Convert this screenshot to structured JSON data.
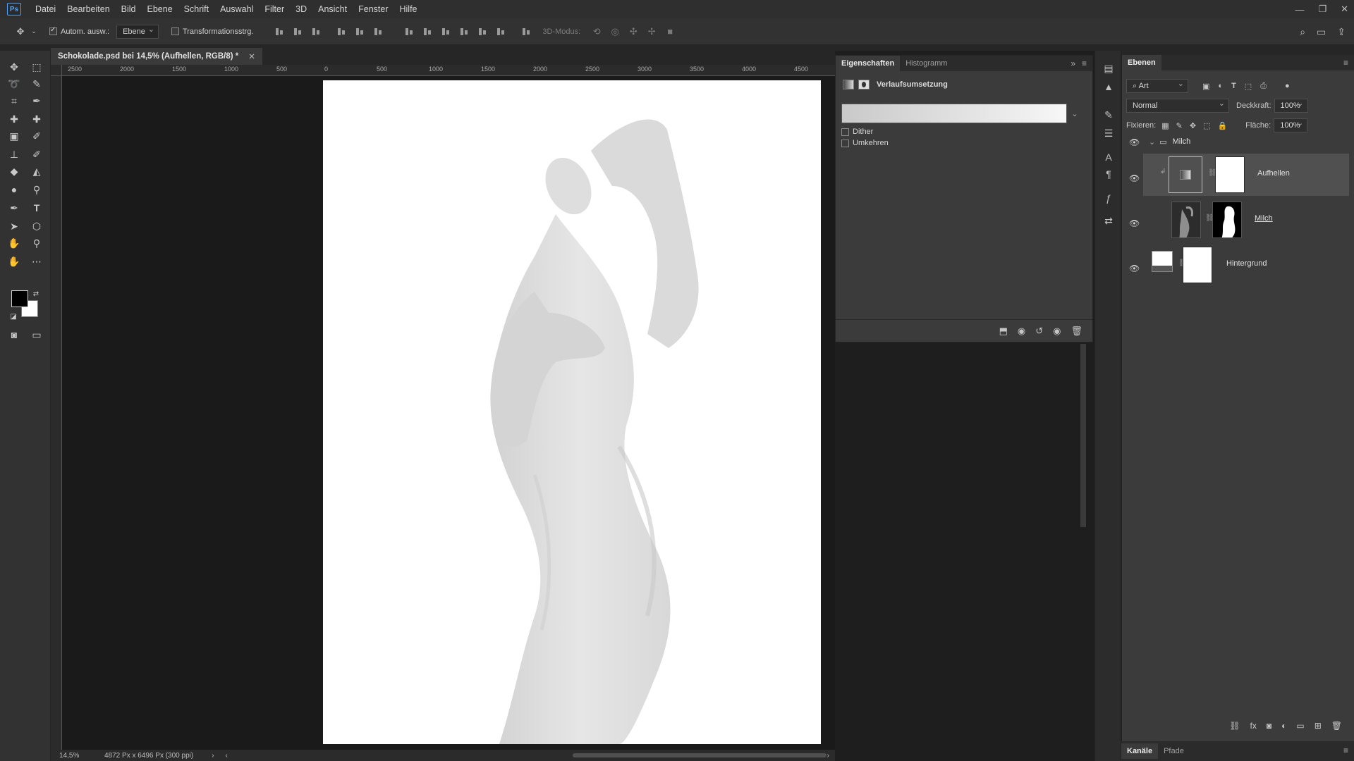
{
  "app": {
    "logo": "Ps",
    "menu": [
      "Datei",
      "Bearbeiten",
      "Bild",
      "Ebene",
      "Schrift",
      "Auswahl",
      "Filter",
      "3D",
      "Ansicht",
      "Fenster",
      "Hilfe"
    ]
  },
  "options_bar": {
    "auto_select_label": "Autom. ausw.:",
    "auto_select_checked": true,
    "auto_select_target": "Ebene",
    "transform_label": "Transformationsstrg.",
    "transform_checked": false,
    "mode3d_label": "3D-Modus:"
  },
  "document": {
    "tab_title": "Schokolade.psd bei 14,5% (Aufhellen, RGB/8) *",
    "ruler_h_labels": [
      "2500",
      "2000",
      "1500",
      "1000",
      "500",
      "0",
      "500",
      "1000",
      "1500",
      "2000",
      "2500",
      "3000",
      "3500",
      "4000",
      "4500"
    ],
    "zoom": "14,5%",
    "doc_info": "4872 Px x 6496 Px (300 ppi)"
  },
  "properties": {
    "tabs": [
      "Eigenschaften",
      "Histogramm"
    ],
    "active_tab": "Eigenschaften",
    "adjustment_name": "Verlaufsumsetzung",
    "dither_label": "Dither",
    "reverse_label": "Umkehren",
    "gradient_start": "#c9c9c9",
    "gradient_end": "#f7f7f7"
  },
  "layers_panel": {
    "title": "Ebenen",
    "filter_kind": "Art",
    "blend_mode": "Normal",
    "opacity_label": "Deckkraft:",
    "opacity_value": "100%",
    "lock_label": "Fixieren:",
    "fill_label": "Fläche:",
    "fill_value": "100%",
    "group_name": "Milch",
    "layers": [
      {
        "name": "Aufhellen"
      },
      {
        "name": "Milch"
      },
      {
        "name": "Hintergrund"
      }
    ]
  },
  "bottom_tabs": [
    "Kanäle",
    "Pfade"
  ],
  "colors": {
    "foreground": "#000000",
    "background": "#ffffff",
    "accent": "#4aa3ff"
  }
}
